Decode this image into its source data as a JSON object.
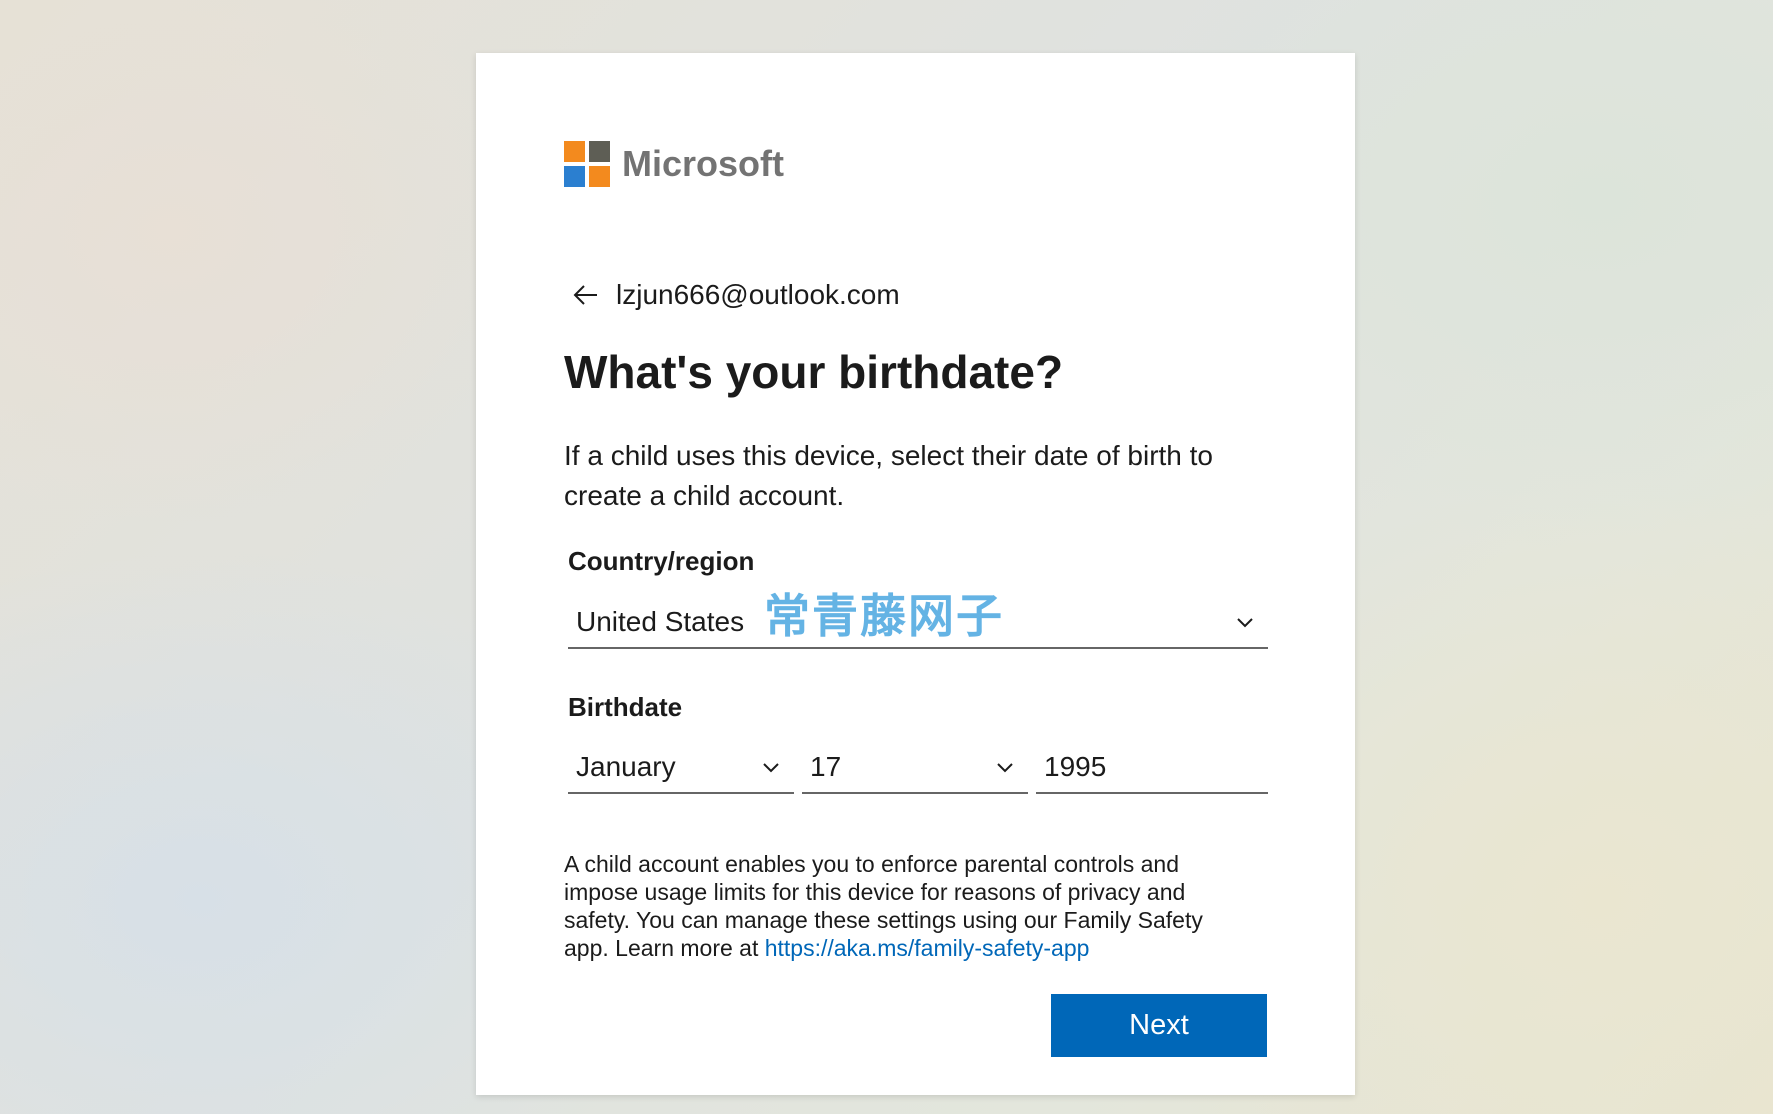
{
  "brand": {
    "name": "Microsoft",
    "colors": {
      "red": "#f25022",
      "green": "#7fba00",
      "blue": "#00a4ef",
      "yellow": "#ffb900"
    }
  },
  "account": {
    "email": "lzjun666@outlook.com",
    "back_icon": "back-arrow-icon"
  },
  "page": {
    "title": "What's your birthdate?",
    "description": "If a child uses this device, select their date of birth to create a child account."
  },
  "country": {
    "label": "Country/region",
    "value": "United States"
  },
  "watermark": "常青藤网子",
  "birthdate": {
    "label": "Birthdate",
    "month": "January",
    "day": "17",
    "year": "1995"
  },
  "info": {
    "text": "A child account enables you to enforce parental controls and impose usage limits for this device for reasons of privacy and safety. You can manage these settings using our Family Safety app. Learn more at ",
    "link": "https://aka.ms/family-safety-app"
  },
  "actions": {
    "next_label": "Next"
  },
  "colors": {
    "accent": "#0067b8",
    "text": "#1b1b1b"
  }
}
